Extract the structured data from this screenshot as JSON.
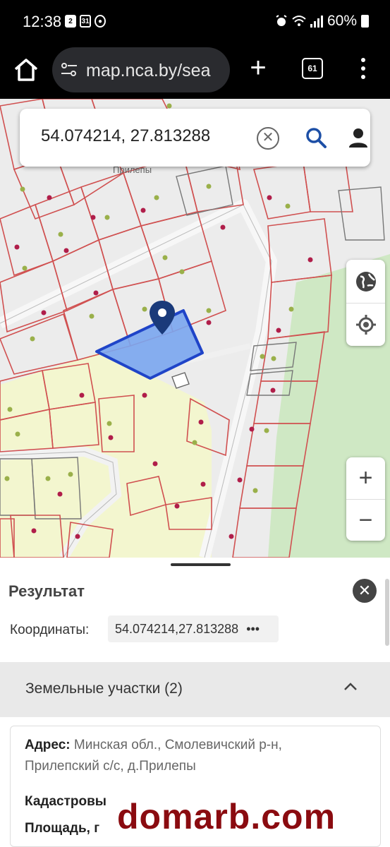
{
  "status_bar": {
    "time": "12:38",
    "notification_icons": [
      "2",
      "31",
      "shield"
    ],
    "battery": "60%"
  },
  "browser": {
    "url": "map.nca.by/sea",
    "tab_count": "61"
  },
  "map": {
    "search_query": "54.074214, 27.813288",
    "village_label": "Прилепы",
    "zoom_in": "+",
    "zoom_out": "−",
    "parcel_color": "#7aa6f0",
    "pin_color": "#1a3a7a",
    "boundary_color": "#d05050",
    "road_color": "#f7f7f7",
    "green_area_color": "#cfe8c4",
    "garden_area_color": "#f3f6cf"
  },
  "result": {
    "title": "Результат",
    "coord_label": "Координаты:",
    "coord_value": "54.074214,27.813288",
    "coord_more": "•••",
    "section_label": "Земельные участки (2)",
    "address_label": "Адрес:",
    "address_line1": "Минская обл., Смолевичский р-н,",
    "address_line2": "Прилепский с/с, д.Прилепы",
    "cadastral_label": "Кадастровы",
    "area_label": "Площадь, г"
  },
  "watermark": "domarb.com"
}
